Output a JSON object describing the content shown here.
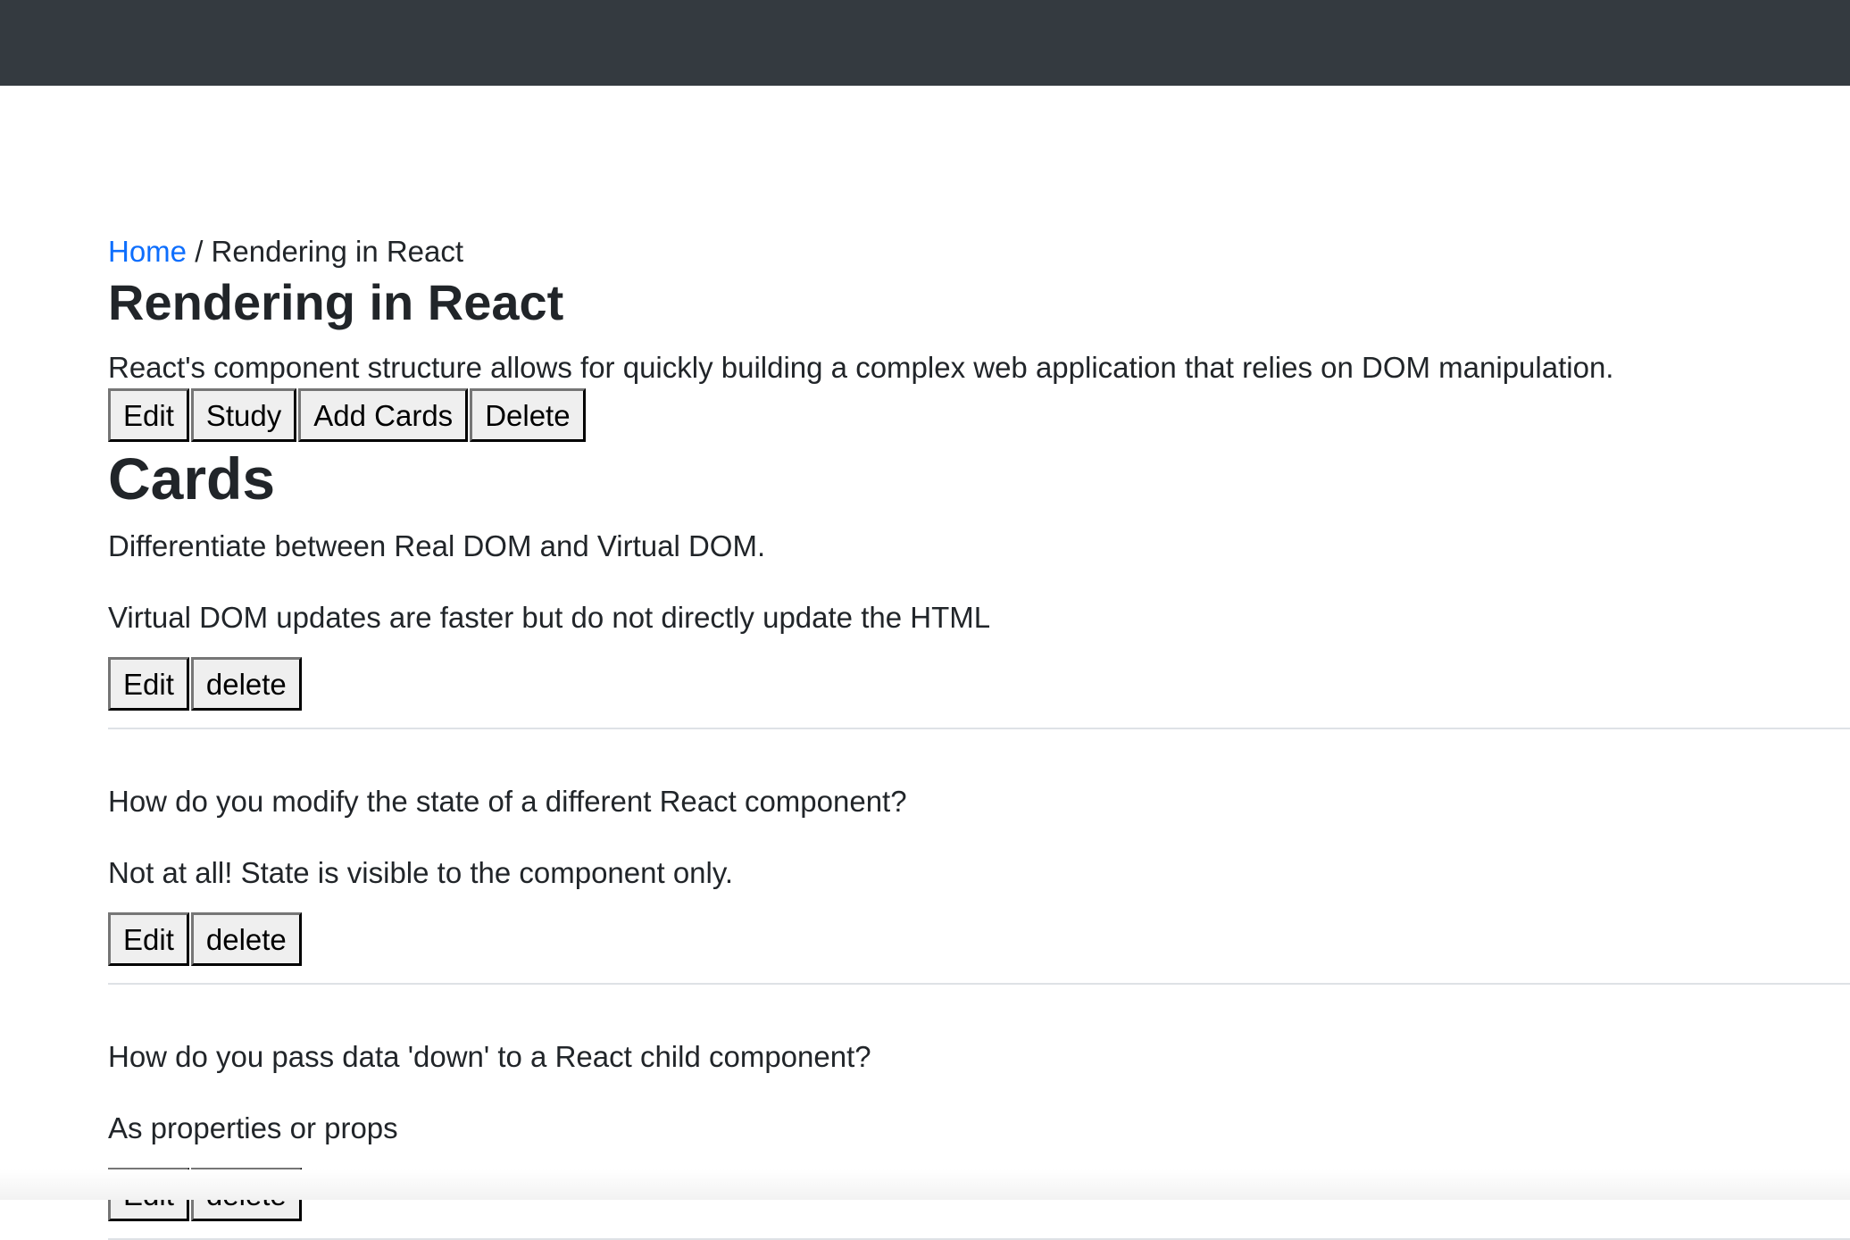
{
  "breadcrumb": {
    "home": "Home",
    "separator": " / ",
    "current": "Rendering in React"
  },
  "deck": {
    "title": "Rendering in React",
    "description": "React's component structure allows for quickly building a complex web application that relies on DOM manipulation.",
    "actions": {
      "edit": "Edit",
      "study": "Study",
      "add_cards": "Add Cards",
      "delete": "Delete"
    }
  },
  "cards_heading": "Cards",
  "cards": [
    {
      "front": "Differentiate between Real DOM and Virtual DOM.",
      "back": "Virtual DOM updates are faster but do not directly update the HTML",
      "edit": "Edit",
      "delete": "delete"
    },
    {
      "front": "How do you modify the state of a different React component?",
      "back": "Not at all! State is visible to the component only.",
      "edit": "Edit",
      "delete": "delete"
    },
    {
      "front": "How do you pass data 'down' to a React child component?",
      "back": "As properties or props",
      "edit": "Edit",
      "delete": "delete"
    }
  ],
  "colors": {
    "navbar": "#343a40",
    "link": "#0d6efd",
    "text": "#212529"
  }
}
